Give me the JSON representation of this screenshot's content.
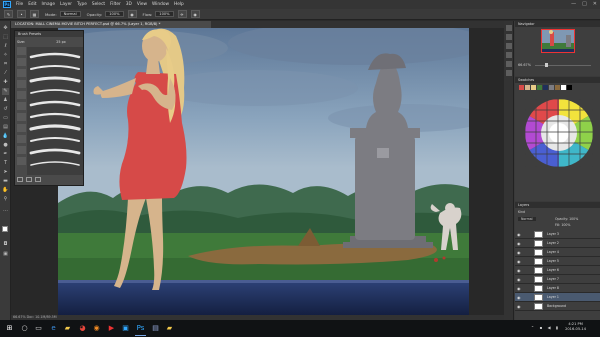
{
  "app": {
    "logo": "Ps",
    "menus": [
      "File",
      "Edit",
      "Image",
      "Layer",
      "Type",
      "Select",
      "Filter",
      "3D",
      "View",
      "Window",
      "Help"
    ],
    "window_controls": [
      "—",
      "□",
      "✕"
    ]
  },
  "options_bar": {
    "mode_label": "Mode:",
    "mode_value": "Normal",
    "opacity_label": "Opacity:",
    "opacity_value": "100%",
    "flow_label": "Flow:",
    "flow_value": "100%"
  },
  "document": {
    "tab_title": "LOCATION: MALL CINEMA MOVIE BITCH PERFECT.psd @ 66.7% (Layer 1, RGB/8) *",
    "status": "66.67%   Doc: 10.1M/89.5M"
  },
  "brush_panel": {
    "title": "Brush Presets",
    "size_label": "Size:",
    "size_value": "25 px"
  },
  "right_panels": {
    "navigator_title": "Navigator",
    "navigator_zoom": "66.67%",
    "swatches_title": "Swatches",
    "layers_title": "Layers",
    "layers_kind": "Kind",
    "layers_blend": "Normal",
    "layers_opacity": "Opacity: 100%",
    "layers_fill": "Fill: 100%",
    "layer_names": [
      "Layer 3",
      "Layer 2",
      "Layer 4",
      "Layer 5",
      "Layer 6",
      "Layer 7",
      "Layer 8",
      "Layer 9",
      "Layer 1",
      "Layer 10",
      "Background"
    ]
  },
  "taskbar": {
    "time": "4:21 PM",
    "date": "2016-05-14",
    "apps": [
      "start",
      "search",
      "task-view",
      "edge",
      "explorer",
      "chrome",
      "firefox",
      "media",
      "photoshop",
      "store",
      "folder",
      "mail"
    ]
  },
  "colors": {
    "accent": "#31a8ff",
    "dress": "#d94848",
    "skin": "#d6b48c",
    "hair": "#e8cc88",
    "sky": "#6d8aa8",
    "water": "#1f2f5a",
    "statue": "#7c7c82"
  }
}
